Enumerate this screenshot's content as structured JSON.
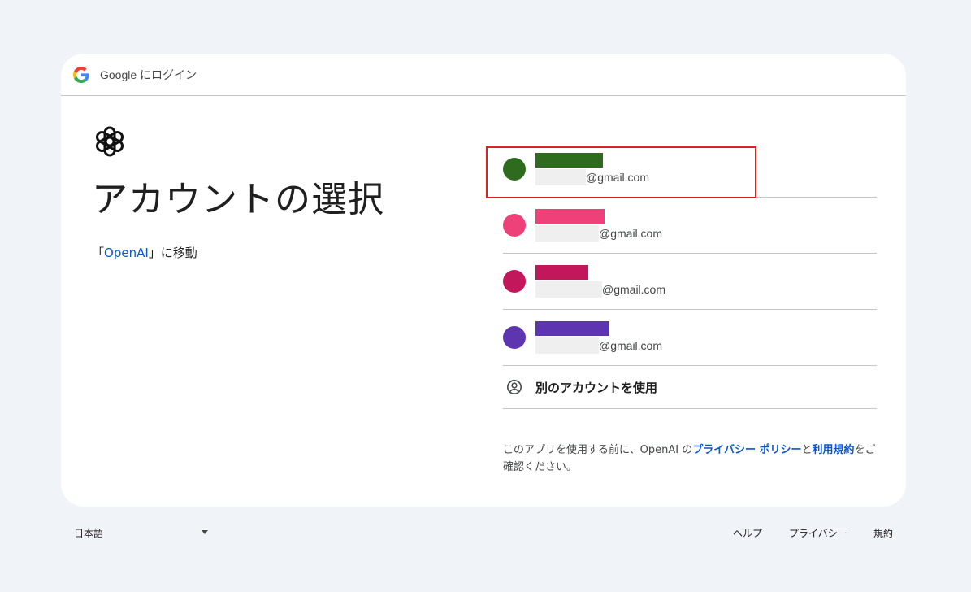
{
  "header": {
    "title": "Google にログイン"
  },
  "main": {
    "title": "アカウントの選択",
    "subtitle_prefix": "「",
    "subtitle_link": "OpenAI",
    "subtitle_suffix": "」に移動"
  },
  "accounts": [
    {
      "email_suffix": "@gmail.com",
      "avatar_color": "#2e6b1f",
      "name_color": "#2e6b1f",
      "selected": true
    },
    {
      "email_suffix": "@gmail.com",
      "avatar_color": "#ee4079",
      "name_color": "#ee4079",
      "selected": false
    },
    {
      "email_suffix": "@gmail.com",
      "avatar_color": "#c2185b",
      "name_color": "#c2185b",
      "selected": false
    },
    {
      "email_suffix": "@gmail.com",
      "avatar_color": "#5e35b1",
      "name_color": "#5e35b1",
      "selected": false
    }
  ],
  "use_another": {
    "label": "別のアカウントを使用",
    "icon": "account-circle-icon"
  },
  "disclaimer": {
    "prefix": "このアプリを使用する前に、OpenAI の",
    "privacy_link": "プライバシー ポリシー",
    "middle": "と",
    "terms_link": "利用規約",
    "suffix": "をご確認ください。"
  },
  "footer": {
    "language": "日本語",
    "links": [
      "ヘルプ",
      "プライバシー",
      "規約"
    ]
  },
  "colors": {
    "link": "#0b57d0",
    "highlight": "#dd2222",
    "background": "#f0f3f8"
  }
}
